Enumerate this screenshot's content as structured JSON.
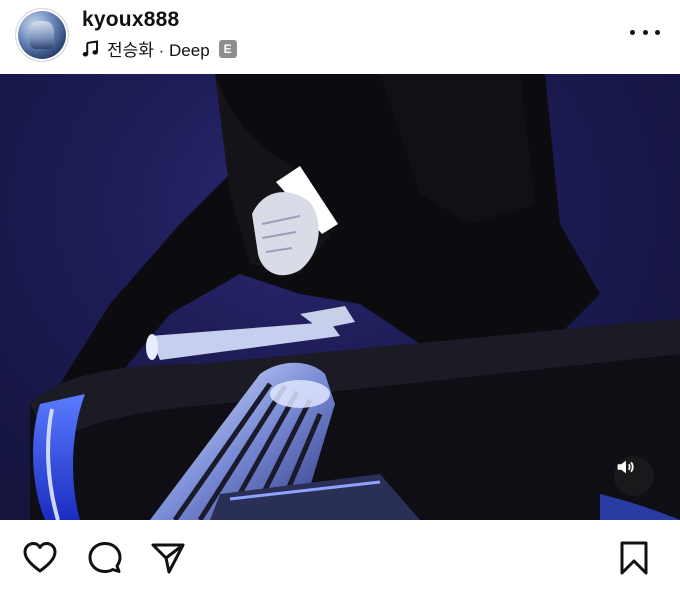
{
  "post": {
    "username": "kyoux888",
    "music": {
      "song": "전승화 · Deep",
      "explicit_badge": "E"
    }
  },
  "icons": {
    "more": "more-options-icon",
    "music": "music-note-icon",
    "sound": "speaker-icon",
    "like": "heart-icon",
    "comment": "comment-bubble-icon",
    "share": "paper-plane-icon",
    "save": "bookmark-icon"
  },
  "colors": {
    "background": "#ffffff",
    "text": "#111111",
    "explicit_badge": "#8e8e8e",
    "media_bg": "#1d1c55"
  }
}
